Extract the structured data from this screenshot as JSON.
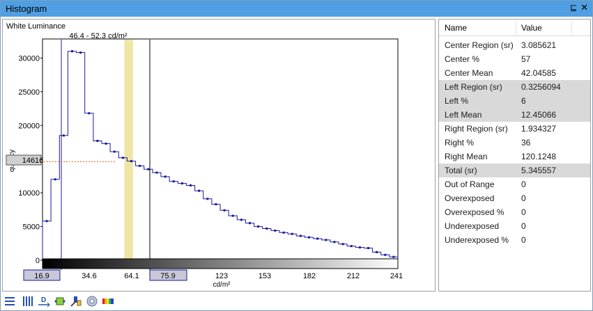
{
  "window": {
    "title": "Histogram",
    "pin_glyph": "⊑",
    "close_glyph": "✕"
  },
  "plot": {
    "label": "White Luminance",
    "range_label": "46.4 - 52.3  cd/m²",
    "ylabel_partial": "quency",
    "xunit": "cd/m²",
    "cursor_value": "14616",
    "left_box": "16.9",
    "right_box": "75.9"
  },
  "chart_data": {
    "type": "histogram",
    "ylim": [
      0,
      32000
    ],
    "yticks": [
      0,
      5000,
      10000,
      15000,
      20000,
      25000,
      30000
    ],
    "xticks": [
      "34.6",
      "64.1",
      "123",
      "153",
      "182",
      "212",
      "241"
    ],
    "bin_count": 42,
    "values": [
      5800,
      12000,
      18500,
      31000,
      30800,
      21800,
      17700,
      17300,
      16100,
      15200,
      14700,
      14000,
      13500,
      13000,
      12400,
      11700,
      11400,
      11100,
      10300,
      9100,
      8300,
      7400,
      6600,
      6000,
      5500,
      5000,
      4700,
      4400,
      4100,
      3900,
      3600,
      3400,
      3200,
      3000,
      2700,
      2400,
      2100,
      1900,
      1800,
      1200,
      800,
      500
    ],
    "cursor_value": 14616,
    "highlight_range": [
      46.4,
      52.3
    ],
    "region_edges": [
      16.9,
      75.9
    ]
  },
  "table": {
    "headers": [
      "Name",
      "Value"
    ],
    "rows": [
      {
        "name": "Center Region (sr)",
        "value": "3.085621",
        "shaded": false
      },
      {
        "name": "Center %",
        "value": "57",
        "shaded": false
      },
      {
        "name": "Center Mean",
        "value": "42.04585",
        "shaded": false
      },
      {
        "name": "Left Region (sr)",
        "value": "0.3256094",
        "shaded": true
      },
      {
        "name": "Left %",
        "value": "6",
        "shaded": true
      },
      {
        "name": "Left Mean",
        "value": "12.45066",
        "shaded": true
      },
      {
        "name": "Right Region (sr)",
        "value": "1.934327",
        "shaded": false
      },
      {
        "name": "Right %",
        "value": "36",
        "shaded": false
      },
      {
        "name": "Right Mean",
        "value": "120.1248",
        "shaded": false
      },
      {
        "name": "Total (sr)",
        "value": "5.345557",
        "shaded": true
      },
      {
        "name": "Out of Range",
        "value": "0",
        "shaded": false
      },
      {
        "name": "Overexposed",
        "value": "0",
        "shaded": false
      },
      {
        "name": "Overexposed %",
        "value": "0",
        "shaded": false
      },
      {
        "name": "Underexposed",
        "value": "0",
        "shaded": false
      },
      {
        "name": "Underexposed %",
        "value": "0",
        "shaded": false
      }
    ]
  },
  "toolbar": {
    "buttons": [
      {
        "name": "list-view-icon"
      },
      {
        "name": "columns-icon"
      },
      {
        "name": "distribution-icon"
      },
      {
        "name": "fit-range-icon"
      },
      {
        "name": "measure-tool-icon"
      },
      {
        "name": "settings-gear-icon"
      },
      {
        "name": "color-palette-icon"
      }
    ]
  },
  "colors": {
    "series": "#1a1a9c",
    "highlight": "#efe6a6",
    "cursor": "#e06010",
    "region_box_fill": "#c8c8d8"
  }
}
